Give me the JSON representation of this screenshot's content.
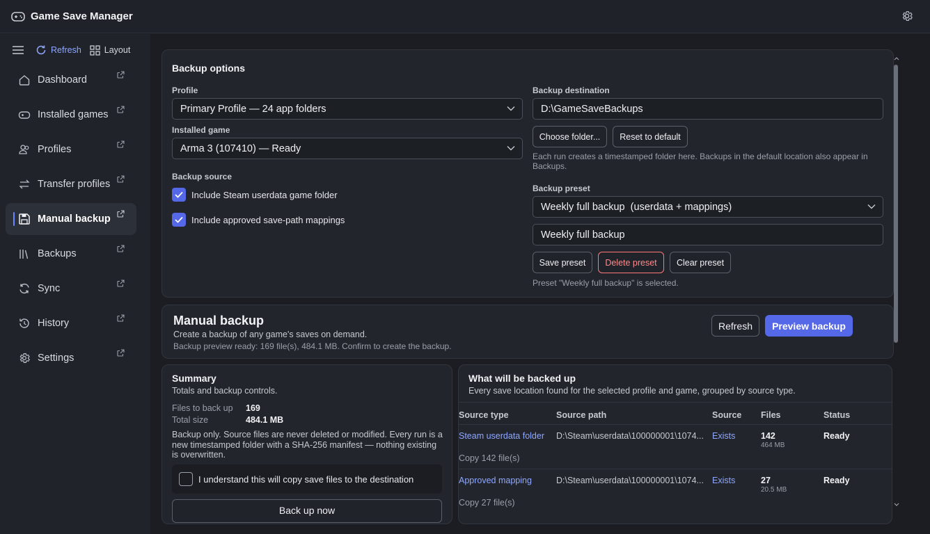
{
  "app": {
    "title": "Game Save Manager"
  },
  "sidebar": {
    "tools": {
      "refresh": "Refresh",
      "layout": "Layout"
    },
    "items": [
      {
        "label": "Dashboard",
        "icon": "home-icon"
      },
      {
        "label": "Installed games",
        "icon": "gamepad-icon"
      },
      {
        "label": "Profiles",
        "icon": "users-icon"
      },
      {
        "label": "Transfer profiles",
        "icon": "transfer-icon"
      },
      {
        "label": "Manual backup",
        "icon": "save-icon",
        "active": true
      },
      {
        "label": "Backups",
        "icon": "library-icon"
      },
      {
        "label": "Sync",
        "icon": "sync-icon"
      },
      {
        "label": "History",
        "icon": "history-icon"
      },
      {
        "label": "Settings",
        "icon": "gear-icon"
      }
    ]
  },
  "backup_options": {
    "title": "Backup options",
    "profile_label": "Profile",
    "profile_value": "Primary Profile — 24 app folders",
    "game_label": "Installed game",
    "game_value": "Arma 3 (107410) — Ready",
    "source_label": "Backup source",
    "source_opt1": "Include Steam userdata game folder",
    "source_opt2": "Include approved save-path mappings",
    "dest_label": "Backup destination",
    "dest_value": "D:\\GameSaveBackups",
    "choose_folder": "Choose folder...",
    "reset_default": "Reset to default",
    "dest_hint": "Each run creates a timestamped folder here. Backups in the default location also appear in Backups.",
    "preset_label": "Backup preset",
    "preset_value": "Weekly full backup  (userdata + mappings)",
    "preset_name": "Weekly full backup",
    "save_preset": "Save preset",
    "delete_preset": "Delete preset",
    "clear_preset": "Clear preset",
    "preset_hint": "Preset \"Weekly full backup\" is selected."
  },
  "manual_backup": {
    "title": "Manual backup",
    "subtitle": "Create a backup of any game's saves on demand.",
    "status": "Backup preview ready: 169 file(s), 484.1 MB. Confirm to create the backup.",
    "refresh": "Refresh",
    "preview": "Preview backup"
  },
  "summary": {
    "title": "Summary",
    "subtitle": "Totals and backup controls.",
    "files_label": "Files to back up",
    "files_value": "169",
    "size_label": "Total size",
    "size_value": "484.1 MB",
    "note": "Backup only. Source files are never deleted or modified. Every run is a new timestamped folder with a SHA-256 manifest — nothing existing is overwritten.",
    "confirm": "I understand this will copy save files to the destination",
    "backup_now": "Back up now"
  },
  "what": {
    "title": "What will be backed up",
    "subtitle": "Every save location found for the selected profile and game, grouped by source type.",
    "columns": [
      "Source type",
      "Source path",
      "Source",
      "Files",
      "Status"
    ],
    "rows": [
      {
        "type": "Steam userdata folder",
        "path": "D:\\Steam\\userdata\\100000001\\1074...",
        "source": "Exists",
        "files": "142",
        "size": "464 MB",
        "status": "Ready",
        "note": "Copy 142 file(s)"
      },
      {
        "type": "Approved mapping",
        "path": "D:\\Steam\\userdata\\100000001\\1074...",
        "source": "Exists",
        "files": "27",
        "size": "20.5 MB",
        "status": "Ready",
        "note": "Copy 27 file(s)"
      }
    ]
  },
  "colors": {
    "accent": "#5468e8",
    "link": "#8fa8ff",
    "danger": "#ff8a8a",
    "background": "#1b1d22"
  }
}
